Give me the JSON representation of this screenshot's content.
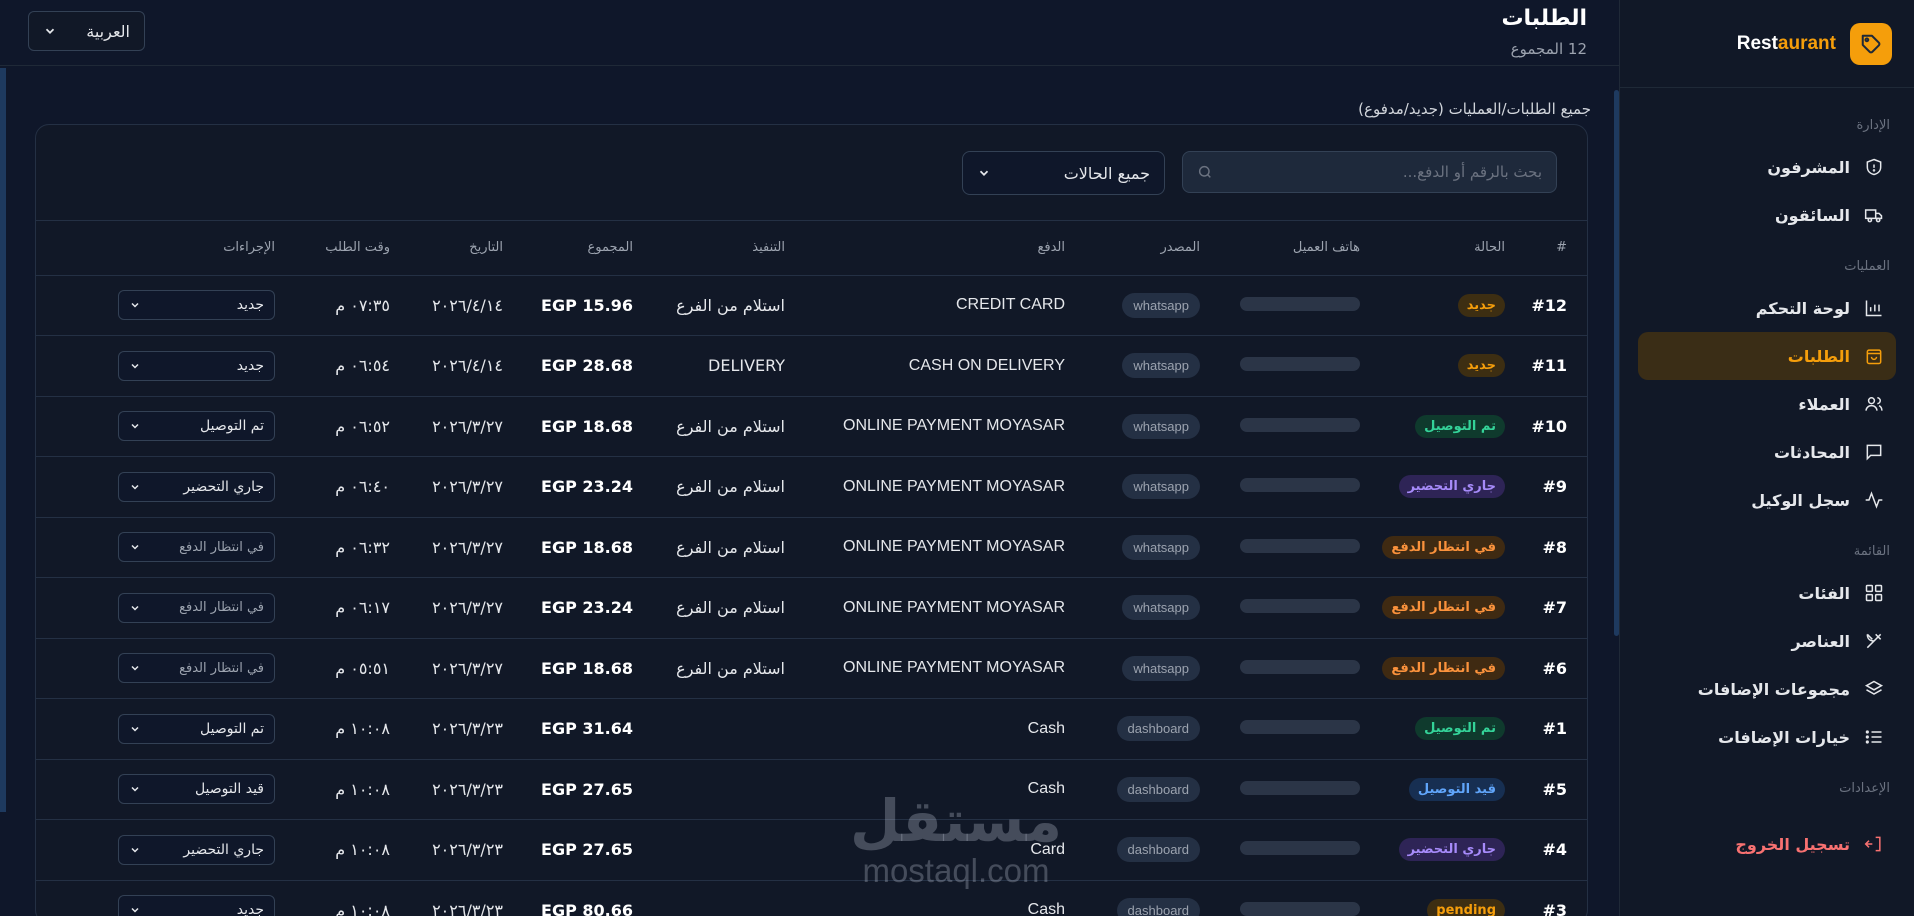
{
  "brand": {
    "name_main": "Rest",
    "name_accent": "aurant",
    "logo_icon": "tag-icon",
    "accent": "#f59e0b"
  },
  "sidebar": {
    "sections": [
      {
        "title": "الإدارة",
        "items": [
          {
            "label": "المشرفون",
            "icon": "shield-icon"
          },
          {
            "label": "السائقون",
            "icon": "truck-icon"
          }
        ]
      },
      {
        "title": "العمليات",
        "items": [
          {
            "label": "لوحة التحكم",
            "icon": "chart-icon"
          },
          {
            "label": "الطلبات",
            "icon": "shopping-bag-icon",
            "active": true
          },
          {
            "label": "العملاء",
            "icon": "users-icon"
          },
          {
            "label": "المحادثات",
            "icon": "chat-icon"
          },
          {
            "label": "سجل الوكيل",
            "icon": "activity-icon"
          }
        ]
      },
      {
        "title": "القائمة",
        "items": [
          {
            "label": "الفئات",
            "icon": "grid-icon"
          },
          {
            "label": "العناصر",
            "icon": "utensils-icon"
          },
          {
            "label": "مجموعات الإضافات",
            "icon": "layers-icon"
          },
          {
            "label": "خيارات الإضافات",
            "icon": "list-icon"
          }
        ]
      },
      {
        "title": "الإعدادات",
        "items": []
      }
    ],
    "logout": {
      "label": "تسجيل الخروج",
      "icon": "logout-icon"
    }
  },
  "header": {
    "title": "الطلبات",
    "count": "12 المجموع",
    "language": "العربية"
  },
  "subtitle": "جميع الطلبات/العمليات (جديد/مدفوع)",
  "filters": {
    "search_placeholder": "بحث بالرقم أو الدفع...",
    "status_value": "جميع الحالات"
  },
  "columns": [
    "#",
    "الحالة",
    "هاتف العميل",
    "المصدر",
    "الدفع",
    "التنفيذ",
    "المجموع",
    "التاريخ",
    "وقت الطلب",
    "الإجراءات"
  ],
  "orders": [
    {
      "id": "#12",
      "status": "جديد",
      "status_kind": "new",
      "source": "whatsapp",
      "payment": "CREDIT CARD",
      "fulfillment": "استلام من الفرع",
      "total": "EGP 15.96",
      "date": "٢٠٢٦/٤/١٤",
      "time": "٠٧:٣٥ م",
      "action": "جديد"
    },
    {
      "id": "#11",
      "status": "جديد",
      "status_kind": "new",
      "source": "whatsapp",
      "payment": "CASH ON DELIVERY",
      "fulfillment": "DELIVERY",
      "total": "EGP 28.68",
      "date": "٢٠٢٦/٤/١٤",
      "time": "٠٦:٥٤ م",
      "action": "جديد"
    },
    {
      "id": "#10",
      "status": "تم التوصيل",
      "status_kind": "delivered",
      "source": "whatsapp",
      "payment": "ONLINE PAYMENT MOYASAR",
      "fulfillment": "استلام من الفرع",
      "total": "EGP 18.68",
      "date": "٢٠٢٦/٣/٢٧",
      "time": "٠٦:٥٢ م",
      "action": "تم التوصيل"
    },
    {
      "id": "#9",
      "status": "جاري التحضير",
      "status_kind": "preparing",
      "source": "whatsapp",
      "payment": "ONLINE PAYMENT MOYASAR",
      "fulfillment": "استلام من الفرع",
      "total": "EGP 23.24",
      "date": "٢٠٢٦/٣/٢٧",
      "time": "٠٦:٤٠ م",
      "action": "جاري التحضير"
    },
    {
      "id": "#8",
      "status": "في انتظار الدفع",
      "status_kind": "awaiting",
      "source": "whatsapp",
      "payment": "ONLINE PAYMENT MOYASAR",
      "fulfillment": "استلام من الفرع",
      "total": "EGP 18.68",
      "date": "٢٠٢٦/٣/٢٧",
      "time": "٠٦:٣٢ م",
      "action": "في انتظار الدفع"
    },
    {
      "id": "#7",
      "status": "في انتظار الدفع",
      "status_kind": "awaiting",
      "source": "whatsapp",
      "payment": "ONLINE PAYMENT MOYASAR",
      "fulfillment": "استلام من الفرع",
      "total": "EGP 23.24",
      "date": "٢٠٢٦/٣/٢٧",
      "time": "٠٦:١٧ م",
      "action": "في انتظار الدفع"
    },
    {
      "id": "#6",
      "status": "في انتظار الدفع",
      "status_kind": "awaiting",
      "source": "whatsapp",
      "payment": "ONLINE PAYMENT MOYASAR",
      "fulfillment": "استلام من الفرع",
      "total": "EGP 18.68",
      "date": "٢٠٢٦/٣/٢٧",
      "time": "٠٥:٥١ م",
      "action": "في انتظار الدفع"
    },
    {
      "id": "#1",
      "status": "تم التوصيل",
      "status_kind": "delivered",
      "source": "dashboard",
      "payment": "Cash",
      "fulfillment": "",
      "total": "EGP 31.64",
      "date": "٢٠٢٦/٣/٢٣",
      "time": "١٠:٠٨ م",
      "action": "تم التوصيل"
    },
    {
      "id": "#5",
      "status": "قيد التوصيل",
      "status_kind": "delivering",
      "source": "dashboard",
      "payment": "Cash",
      "fulfillment": "",
      "total": "EGP 27.65",
      "date": "٢٠٢٦/٣/٢٣",
      "time": "١٠:٠٨ م",
      "action": "قيد التوصيل"
    },
    {
      "id": "#4",
      "status": "جاري التحضير",
      "status_kind": "preparing",
      "source": "dashboard",
      "payment": "Card",
      "fulfillment": "",
      "total": "EGP 27.65",
      "date": "٢٠٢٦/٣/٢٣",
      "time": "١٠:٠٨ م",
      "action": "جاري التحضير"
    },
    {
      "id": "#3",
      "status": "pending",
      "status_kind": "new",
      "source": "dashboard",
      "payment": "Cash",
      "fulfillment": "",
      "total": "EGP 80.66",
      "date": "٢٠٢٦/٣/٢٣",
      "time": "١٠:٠٨ م",
      "action": "جديد"
    }
  ],
  "status_colors": {
    "new": {
      "bg": "#3d2e12",
      "fg": "#f59e0b"
    },
    "delivered": {
      "bg": "#0f3a2d",
      "fg": "#34d399"
    },
    "preparing": {
      "bg": "#2e2456",
      "fg": "#a78bfa"
    },
    "awaiting": {
      "bg": "#3f2a12",
      "fg": "#fb923c"
    },
    "delivering": {
      "bg": "#172f52",
      "fg": "#60a5fa"
    }
  },
  "watermark": {
    "arabic": "مستقل",
    "latin": "mostaql.com"
  }
}
